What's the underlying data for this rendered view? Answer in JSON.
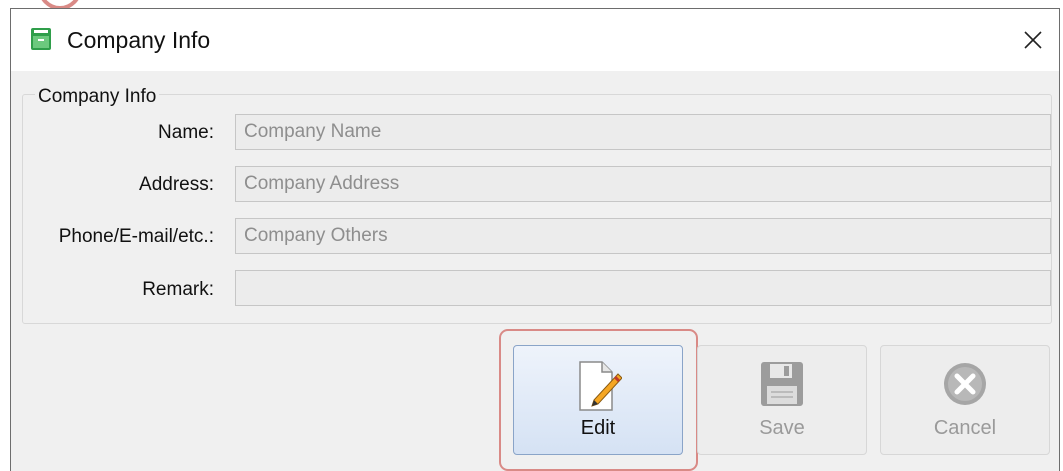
{
  "window": {
    "title": "Company Info",
    "close_glyph": "✕",
    "icon": "app-icon"
  },
  "group": {
    "legend": "Company Info",
    "fields": [
      {
        "label": "Name:",
        "value": "",
        "placeholder": "Company Name"
      },
      {
        "label": "Address:",
        "value": "",
        "placeholder": "Company Address"
      },
      {
        "label": "Phone/E-mail/etc.:",
        "value": "",
        "placeholder": "Company Others"
      },
      {
        "label": "Remark:",
        "value": "",
        "placeholder": ""
      }
    ]
  },
  "toolbar": {
    "edit": {
      "label": "Edit",
      "icon": "edit-document-pencil-icon",
      "enabled": true
    },
    "save": {
      "label": "Save",
      "icon": "floppy-disk-icon",
      "enabled": false
    },
    "cancel": {
      "label": "Cancel",
      "icon": "cancel-x-icon",
      "enabled": false
    }
  },
  "colors": {
    "highlight": "#d98a86",
    "window_bg": "#f0f0f0",
    "active_button": "#d5e2f4"
  }
}
